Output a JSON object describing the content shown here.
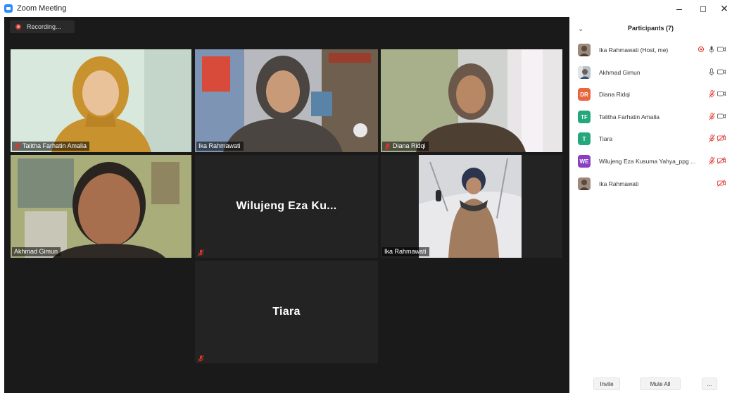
{
  "window": {
    "title": "Zoom Meeting",
    "minimize_glyph": "–",
    "maximize_glyph": "◻",
    "close_glyph": "✕"
  },
  "recording": {
    "label": "Recording..."
  },
  "tiles": [
    {
      "name": "Talitha Farhatin Amalia",
      "muted": true,
      "active": false
    },
    {
      "name": "Ika Rahmawati",
      "muted": false,
      "active": true
    },
    {
      "name": "Diana Ridqi",
      "muted": true,
      "active": false
    },
    {
      "name": "Akhmad Gimun",
      "muted": false,
      "active": false
    },
    {
      "name": "Wilujeng  Eza  Ku...",
      "muted": true,
      "active": false
    },
    {
      "name": "Ika Rahmawati",
      "muted": false,
      "active": false
    },
    {
      "name": "Tiara",
      "muted": true,
      "active": false
    }
  ],
  "panel": {
    "title": "Participants (7)",
    "collapse_glyph": "⌄",
    "participants": [
      {
        "initials": "",
        "name": "Ika Rahmawati (Host, me)",
        "avatar_color": "#7c6a5a",
        "photo": true,
        "mic": "on",
        "video": "on",
        "host": true
      },
      {
        "initials": "",
        "name": "Akhmad Gimun",
        "avatar_color": "#9aa4ad",
        "photo": true,
        "mic": "on",
        "video": "on",
        "host": false
      },
      {
        "initials": "DR",
        "name": "Diana Ridqi",
        "avatar_color": "#e8663d",
        "photo": false,
        "mic": "off",
        "video": "on",
        "host": false
      },
      {
        "initials": "TF",
        "name": "Talitha Farhatin Amalia",
        "avatar_color": "#23a77b",
        "photo": false,
        "mic": "off",
        "video": "on",
        "host": false
      },
      {
        "initials": "T",
        "name": "Tiara",
        "avatar_color": "#23a77b",
        "photo": false,
        "mic": "off",
        "video": "off",
        "host": false
      },
      {
        "initials": "WE",
        "name": "Wilujeng Eza Kusuma Yahya_ppg ...",
        "avatar_color": "#8a3fc2",
        "photo": false,
        "mic": "off",
        "video": "off",
        "host": false
      },
      {
        "initials": "",
        "name": "Ika Rahmawati",
        "avatar_color": "#7c6a5a",
        "photo": true,
        "mic": "none",
        "video": "off",
        "host": false
      }
    ],
    "footer": {
      "invite": "Invite",
      "mute_all": "Mute All",
      "more": "..."
    }
  },
  "colors": {
    "active_speaker": "#c7e06a",
    "muted_red": "#e0332d",
    "zoom_blue": "#2d8cff"
  }
}
